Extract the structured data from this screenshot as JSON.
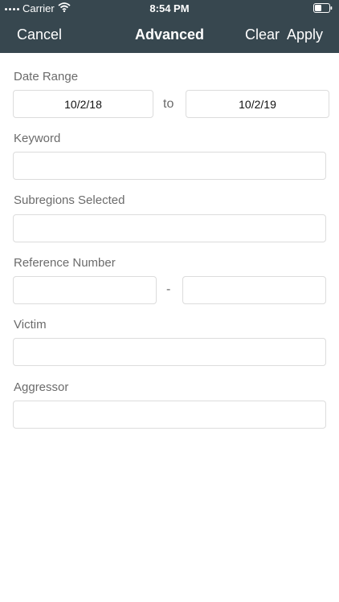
{
  "status_bar": {
    "carrier": "Carrier",
    "time": "8:54 PM"
  },
  "nav": {
    "cancel_label": "Cancel",
    "title": "Advanced",
    "clear_label": "Clear",
    "apply_label": "Apply"
  },
  "form": {
    "date_range": {
      "label": "Date Range",
      "from_value": "10/2/18",
      "separator": "to",
      "to_value": "10/2/19"
    },
    "keyword": {
      "label": "Keyword",
      "value": ""
    },
    "subregions": {
      "label": "Subregions Selected",
      "value": ""
    },
    "reference_number": {
      "label": "Reference Number",
      "from_value": "",
      "separator": "-",
      "to_value": ""
    },
    "victim": {
      "label": "Victim",
      "value": ""
    },
    "aggressor": {
      "label": "Aggressor",
      "value": ""
    }
  },
  "colors": {
    "header_bg": "#37474f",
    "header_text": "#ffffff",
    "label_text": "#6b6b6b",
    "field_border": "#dcdcdc"
  },
  "icons": {
    "signal": "signal-dots-icon",
    "wifi": "wifi-icon",
    "battery": "battery-icon"
  }
}
